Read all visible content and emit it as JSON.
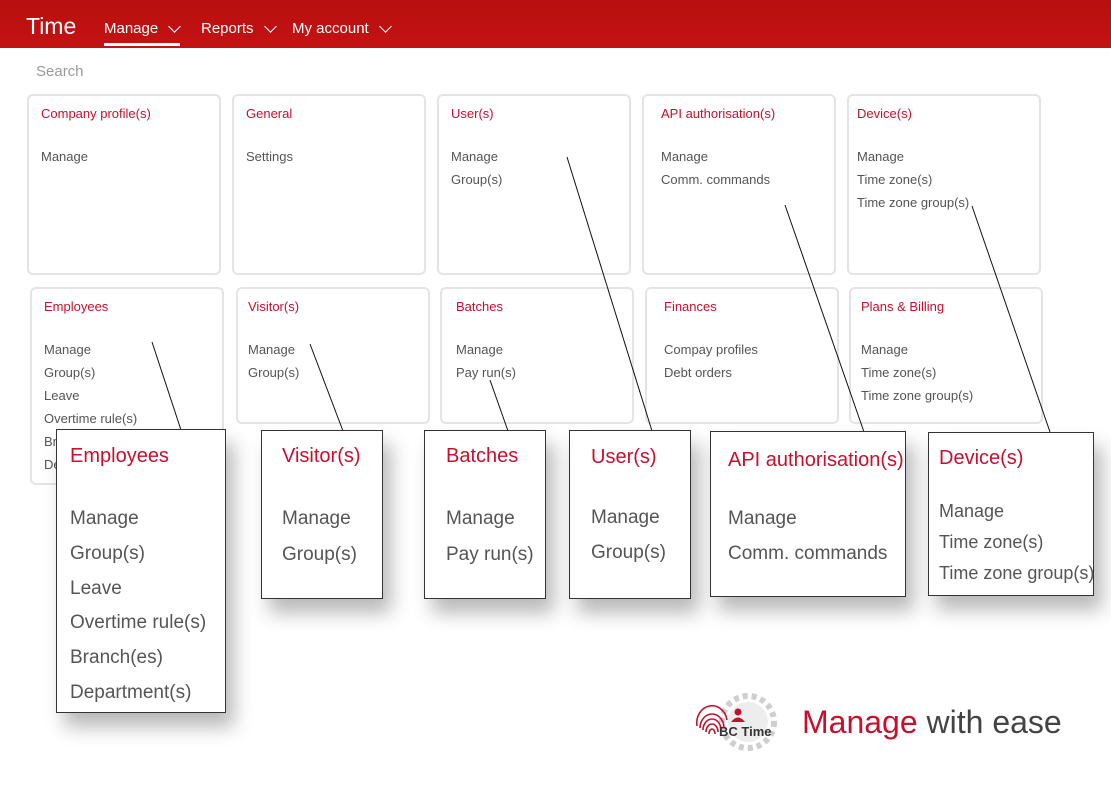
{
  "app": {
    "title": "Time"
  },
  "nav": [
    {
      "label": "Manage"
    },
    {
      "label": "Reports"
    },
    {
      "label": "My account"
    }
  ],
  "search": {
    "placeholder": "Search"
  },
  "cards": [
    {
      "title": "Company profile(s)",
      "links": [
        "Manage"
      ]
    },
    {
      "title": "General",
      "links": [
        "Settings"
      ]
    },
    {
      "title": "User(s)",
      "links": [
        "Manage",
        "Group(s)"
      ]
    },
    {
      "title": "API authorisation(s)",
      "links": [
        "Manage",
        "Comm. commands"
      ]
    },
    {
      "title": "Device(s)",
      "links": [
        "Manage",
        "Time zone(s)",
        "Time zone group(s)"
      ]
    },
    {
      "title": "Employees",
      "links": [
        "Manage",
        "Group(s)",
        "Leave",
        "Overtime rule(s)",
        "Br",
        "De"
      ]
    },
    {
      "title": "Visitor(s)",
      "links": [
        "Manage",
        "Group(s)"
      ]
    },
    {
      "title": "Batches",
      "links": [
        "Manage",
        "Pay run(s)"
      ]
    },
    {
      "title": "Finances",
      "links": [
        "Compay profiles",
        "Debt orders"
      ]
    },
    {
      "title": "Plans & Billing",
      "links": [
        "Manage",
        "Time zone(s)",
        "Time zone group(s)"
      ]
    }
  ],
  "zoom": [
    {
      "title": "Employees",
      "links": [
        "Manage",
        "Group(s)",
        "Leave",
        "Overtime rule(s)",
        "Branch(es)",
        "Department(s)"
      ]
    },
    {
      "title": "Visitor(s)",
      "links": [
        "Manage",
        "Group(s)"
      ]
    },
    {
      "title": "Batches",
      "links": [
        "Manage",
        "Pay run(s)"
      ]
    },
    {
      "title": "User(s)",
      "links": [
        "Manage",
        "Group(s)"
      ]
    },
    {
      "title": "API authorisation(s)",
      "links": [
        "Manage",
        "Comm. commands"
      ]
    },
    {
      "title": "Device(s)",
      "links": [
        "Manage",
        "Time zone(s)",
        "Time zone group(s)"
      ]
    }
  ],
  "footer": {
    "logo_text": "BC Time",
    "tagline_highlight": "Manage",
    "tagline_rest": " with ease"
  },
  "colors": {
    "brand": "#c8102e",
    "nav_bg": "#c41212",
    "text": "#555555",
    "card_border": "#e4e4e4"
  }
}
